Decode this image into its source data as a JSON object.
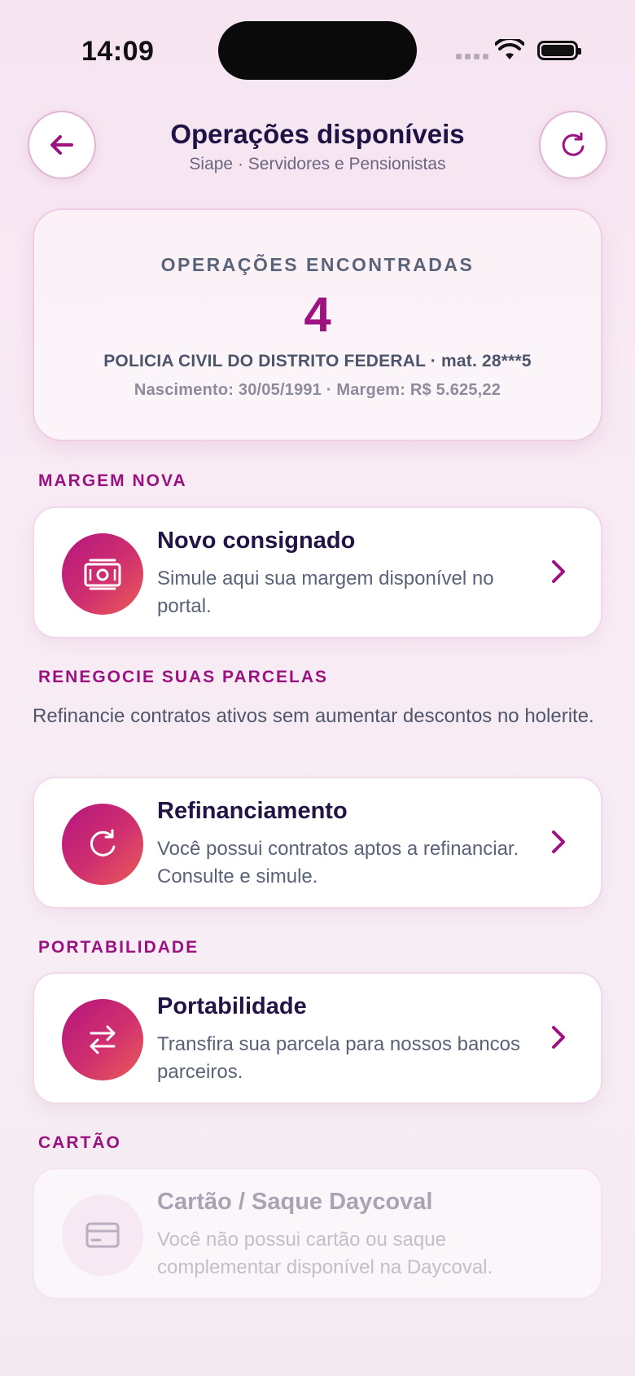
{
  "status_bar": {
    "time": "14:09"
  },
  "header": {
    "title": "Operações disponíveis",
    "subtitle": "Siape · Servidores e Pensionistas"
  },
  "summary": {
    "label": "OPERAÇÕES ENCONTRADAS",
    "count": "4",
    "org_line": "POLICIA CIVIL DO DISTRITO FEDERAL · mat. 28***5",
    "details_line": "Nascimento: 30/05/1991 · Margem: R$ 5.625,22"
  },
  "sections": {
    "margem_nova": {
      "title": "MARGEM NOVA",
      "card": {
        "title": "Novo consignado",
        "description": "Simule aqui sua margem disponível no portal.",
        "icon": "money-icon"
      }
    },
    "renegocie": {
      "title": "RENEGOCIE SUAS PARCELAS",
      "description": "Refinancie contratos ativos sem aumentar descontos no holerite.",
      "card": {
        "title": "Refinanciamento",
        "description": "Você possui contratos aptos a refinanciar. Consulte e simule.",
        "icon": "refresh-icon"
      }
    },
    "portabilidade": {
      "title": "PORTABILIDADE",
      "card": {
        "title": "Portabilidade",
        "description": "Transfira sua parcela para nossos bancos parceiros.",
        "icon": "transfer-icon"
      }
    },
    "cartao": {
      "title": "CARTÃO",
      "card": {
        "title": "Cartão / Saque Daycoval",
        "description": "Você não possui cartão ou saque complementar disponível na Daycoval.",
        "icon": "credit-card-icon",
        "disabled": true
      }
    }
  },
  "colors": {
    "accent": "#9b1280",
    "title": "#231446",
    "icon_gradient_start": "#b4157f",
    "icon_gradient_end": "#ec5d55"
  }
}
